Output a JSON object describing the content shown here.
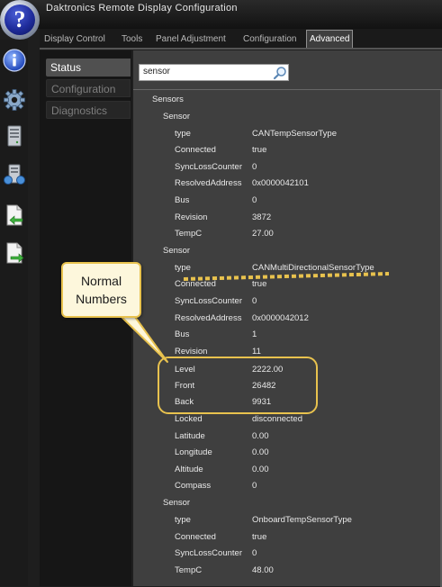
{
  "window": {
    "title": "Daktronics Remote Display Configuration"
  },
  "menu": {
    "tabs": [
      {
        "label": "Display Control"
      },
      {
        "label": "Tools"
      },
      {
        "label": "Panel Adjustment"
      },
      {
        "label": "Configuration"
      },
      {
        "label": "Advanced"
      }
    ],
    "active_tab": "Advanced"
  },
  "sidebar_icons": [
    "info-icon",
    "gear-icon",
    "server-icon",
    "network-server-icon",
    "import-document-icon",
    "export-document-icon"
  ],
  "nav": {
    "items": [
      {
        "label": "Status"
      },
      {
        "label": "Configuration"
      },
      {
        "label": "Diagnostics"
      }
    ],
    "active": "Status"
  },
  "search": {
    "value": "sensor"
  },
  "tree": {
    "root": "Sensors",
    "sensor_heading": "Sensor",
    "sensors": [
      {
        "rows": [
          {
            "key": "type",
            "value": "CANTempSensorType"
          },
          {
            "key": "Connected",
            "value": "true"
          },
          {
            "key": "SyncLossCounter",
            "value": "0"
          },
          {
            "key": "ResolvedAddress",
            "value": "0x0000042101"
          },
          {
            "key": "Bus",
            "value": "0"
          },
          {
            "key": "Revision",
            "value": "3872"
          },
          {
            "key": "TempC",
            "value": "27.00"
          }
        ]
      },
      {
        "rows": [
          {
            "key": "type",
            "value": "CANMultiDirectionalSensorType"
          },
          {
            "key": "Connected",
            "value": "true"
          },
          {
            "key": "SyncLossCounter",
            "value": "0"
          },
          {
            "key": "ResolvedAddress",
            "value": "0x0000042012"
          },
          {
            "key": "Bus",
            "value": "1"
          },
          {
            "key": "Revision",
            "value": "11"
          },
          {
            "key": "Level",
            "value": "2222.00"
          },
          {
            "key": "Front",
            "value": "26482"
          },
          {
            "key": "Back",
            "value": "9931"
          },
          {
            "key": "Locked",
            "value": "disconnected"
          },
          {
            "key": "Latitude",
            "value": "0.00"
          },
          {
            "key": "Longitude",
            "value": "0.00"
          },
          {
            "key": "Altitude",
            "value": "0.00"
          },
          {
            "key": "Compass",
            "value": "0"
          }
        ]
      },
      {
        "rows": [
          {
            "key": "type",
            "value": "OnboardTempSensorType"
          },
          {
            "key": "Connected",
            "value": "true"
          },
          {
            "key": "SyncLossCounter",
            "value": "0"
          },
          {
            "key": "TempC",
            "value": "48.00"
          }
        ]
      }
    ]
  },
  "annotation": {
    "callout_line1": "Normal",
    "callout_line2": "Numbers"
  },
  "colors": {
    "annotation": "#e8c24e",
    "logo_blue": "#1f2c9c",
    "active_tab_border": "#909090"
  }
}
